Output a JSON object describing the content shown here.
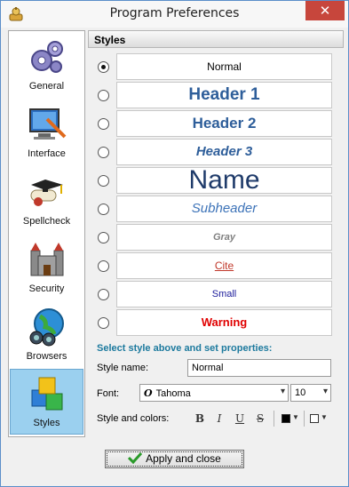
{
  "window": {
    "title": "Program Preferences",
    "close_glyph": "✕"
  },
  "sidebar": {
    "items": [
      {
        "label": "General",
        "icon": "gears-icon"
      },
      {
        "label": "Interface",
        "icon": "monitor-icon"
      },
      {
        "label": "Spellcheck",
        "icon": "diploma-icon"
      },
      {
        "label": "Security",
        "icon": "castle-icon"
      },
      {
        "label": "Browsers",
        "icon": "globe-binoculars-icon"
      },
      {
        "label": "Styles",
        "icon": "blocks-icon",
        "active": true
      }
    ]
  },
  "panel": {
    "header": "Styles",
    "styles": [
      {
        "label": "Normal",
        "selected": true
      },
      {
        "label": "Header 1"
      },
      {
        "label": "Header 2"
      },
      {
        "label": "Header 3"
      },
      {
        "label": "Name"
      },
      {
        "label": "Subheader"
      },
      {
        "label": "Gray"
      },
      {
        "label": "Cite"
      },
      {
        "label": "Small"
      },
      {
        "label": "Warning"
      }
    ],
    "properties_heading": "Select style above and set properties:",
    "style_name_label": "Style name:",
    "style_name_value": "Normal",
    "font_label": "Font:",
    "font_glyph": "O",
    "font_value": "Tahoma",
    "font_size_value": "10",
    "style_colors_label": "Style and colors:",
    "format_buttons": {
      "bold": "B",
      "italic": "I",
      "underline": "U",
      "strike": "S"
    },
    "text_color": "#000000",
    "bg_color": "#ffffff"
  },
  "footer": {
    "apply_label": "Apply and close"
  },
  "colors": {
    "accent": "#9bd0ef",
    "warning": "#e00000",
    "heading": "#2e5e9a"
  }
}
